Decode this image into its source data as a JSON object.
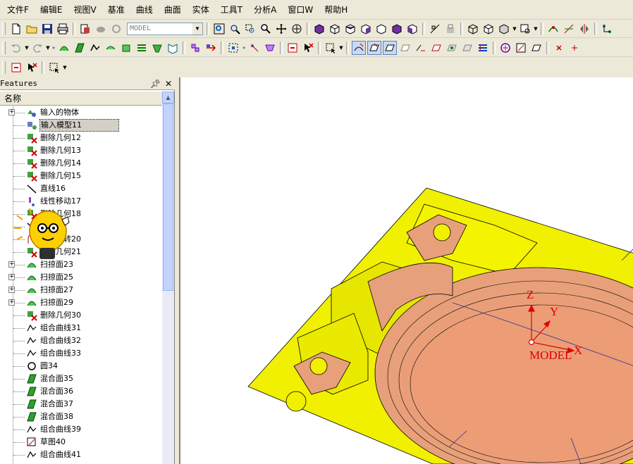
{
  "menu": [
    {
      "label": "文件F"
    },
    {
      "label": "编辑E"
    },
    {
      "label": "视图V"
    },
    {
      "label": "基准"
    },
    {
      "label": "曲线"
    },
    {
      "label": "曲面"
    },
    {
      "label": "实体"
    },
    {
      "label": "工具T"
    },
    {
      "label": "分析A"
    },
    {
      "label": "窗口W"
    },
    {
      "label": "帮助H"
    }
  ],
  "toolbar": {
    "model_select_value": "MODEL"
  },
  "features_panel": {
    "title": "Features",
    "pin_icon": "pin-icon",
    "close_icon": "close-icon",
    "column_header": "名称",
    "items": [
      {
        "label": "输入的物体",
        "icon": "input-object-icon",
        "expandable": true
      },
      {
        "label": "输入模型11",
        "icon": "input-model-icon",
        "selected": true
      },
      {
        "label": "删除几何12",
        "icon": "delete-geometry-icon"
      },
      {
        "label": "删除几何13",
        "icon": "delete-geometry-icon"
      },
      {
        "label": "删除几何14",
        "icon": "delete-geometry-icon"
      },
      {
        "label": "删除几何15",
        "icon": "delete-geometry-icon"
      },
      {
        "label": "直线16",
        "icon": "line-icon"
      },
      {
        "label": "线性移动17",
        "icon": "linear-move-icon"
      },
      {
        "label": "删除几何18",
        "icon": "delete-geometry-icon"
      },
      {
        "label": "直线19",
        "icon": "line-icon"
      },
      {
        "label": "移动旋转20",
        "icon": "move-rotate-icon"
      },
      {
        "label": "删除几何21",
        "icon": "delete-geometry-icon"
      },
      {
        "label": "扫掠面23",
        "icon": "sweep-surface-icon",
        "expandable": true
      },
      {
        "label": "扫掠面25",
        "icon": "sweep-surface-icon",
        "expandable": true
      },
      {
        "label": "扫掠面27",
        "icon": "sweep-surface-icon",
        "expandable": true
      },
      {
        "label": "扫掠面29",
        "icon": "sweep-surface-icon",
        "expandable": true
      },
      {
        "label": "删除几何30",
        "icon": "delete-geometry-icon"
      },
      {
        "label": "组合曲线31",
        "icon": "composite-curve-icon"
      },
      {
        "label": "组合曲线32",
        "icon": "composite-curve-icon"
      },
      {
        "label": "组合曲线33",
        "icon": "composite-curve-icon"
      },
      {
        "label": "圆34",
        "icon": "circle-icon"
      },
      {
        "label": "混合面35",
        "icon": "blend-surface-icon"
      },
      {
        "label": "混合面36",
        "icon": "blend-surface-icon"
      },
      {
        "label": "混合面37",
        "icon": "blend-surface-icon"
      },
      {
        "label": "混合面38",
        "icon": "blend-surface-icon"
      },
      {
        "label": "组合曲线39",
        "icon": "composite-curve-icon"
      },
      {
        "label": "草图40",
        "icon": "sketch-icon"
      },
      {
        "label": "组合曲线41",
        "icon": "composite-curve-icon"
      }
    ]
  },
  "viewport": {
    "axis_labels": {
      "z": "Z",
      "y": "Y",
      "x": "X"
    },
    "coordinate_system_name": "MODEL",
    "colors": {
      "base_plate": "#f0f000",
      "mold_insert": "#e8a07a",
      "axis": "#e00000",
      "edge": "#000000",
      "background": "#ffffff"
    }
  },
  "colors": {
    "chrome": "#ece9d8",
    "selection": "#d4d0c8"
  }
}
